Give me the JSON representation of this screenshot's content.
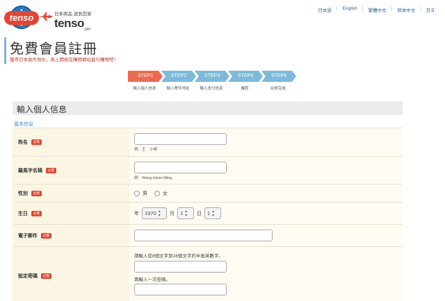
{
  "header": {
    "logo_badge": "tenso",
    "logo_tagline": "日本商品 送到您家",
    "logo_word": "tenso",
    "logo_suffix": ".com",
    "languages": [
      "日本語",
      "English",
      "繁體中文",
      "简体中文",
      "한국"
    ]
  },
  "page": {
    "title": "免費會員註冊",
    "subtitle": "獲得日本收件地址，馬上開始在購物網站進行購物吧！"
  },
  "steps": [
    {
      "label": "STEP1",
      "caption": "輸入個人信息",
      "active": true
    },
    {
      "label": "STEP2",
      "caption": "輸入寄件地址",
      "active": false
    },
    {
      "label": "STEP3",
      "caption": "輸入支付信息",
      "active": false
    },
    {
      "label": "STEP4",
      "caption": "確認",
      "active": false
    },
    {
      "label": "STEP5",
      "caption": "註冊完成",
      "active": false
    }
  ],
  "section": {
    "title": "輸入個人信息",
    "subheading": "基本信息"
  },
  "form": {
    "required_badge": "必需",
    "name": {
      "label": "姓名",
      "value": "",
      "hint": "例：王　小明"
    },
    "romaji": {
      "label": "羅馬字名稱",
      "value": "",
      "hint": "例：Wang Hsiao Ming"
    },
    "gender": {
      "label": "性別",
      "options": [
        "男",
        "女"
      ]
    },
    "birthday": {
      "label": "生日",
      "year_label": "年",
      "year": "1970",
      "month_label": "月",
      "month": "1",
      "day_label": "日",
      "day": "1"
    },
    "email": {
      "label": "電子郵件",
      "value": ""
    },
    "password": {
      "label": "設定密碼",
      "note": "請輸入從8個文字到16個文字的半角英數字。",
      "confirm_note": "再輸入一次密碼。"
    }
  },
  "colors": {
    "accent": "#ee6a4f",
    "step_todo": "#7bbad9",
    "label_bg": "#fbf5e4",
    "link": "#2a5f9e"
  }
}
